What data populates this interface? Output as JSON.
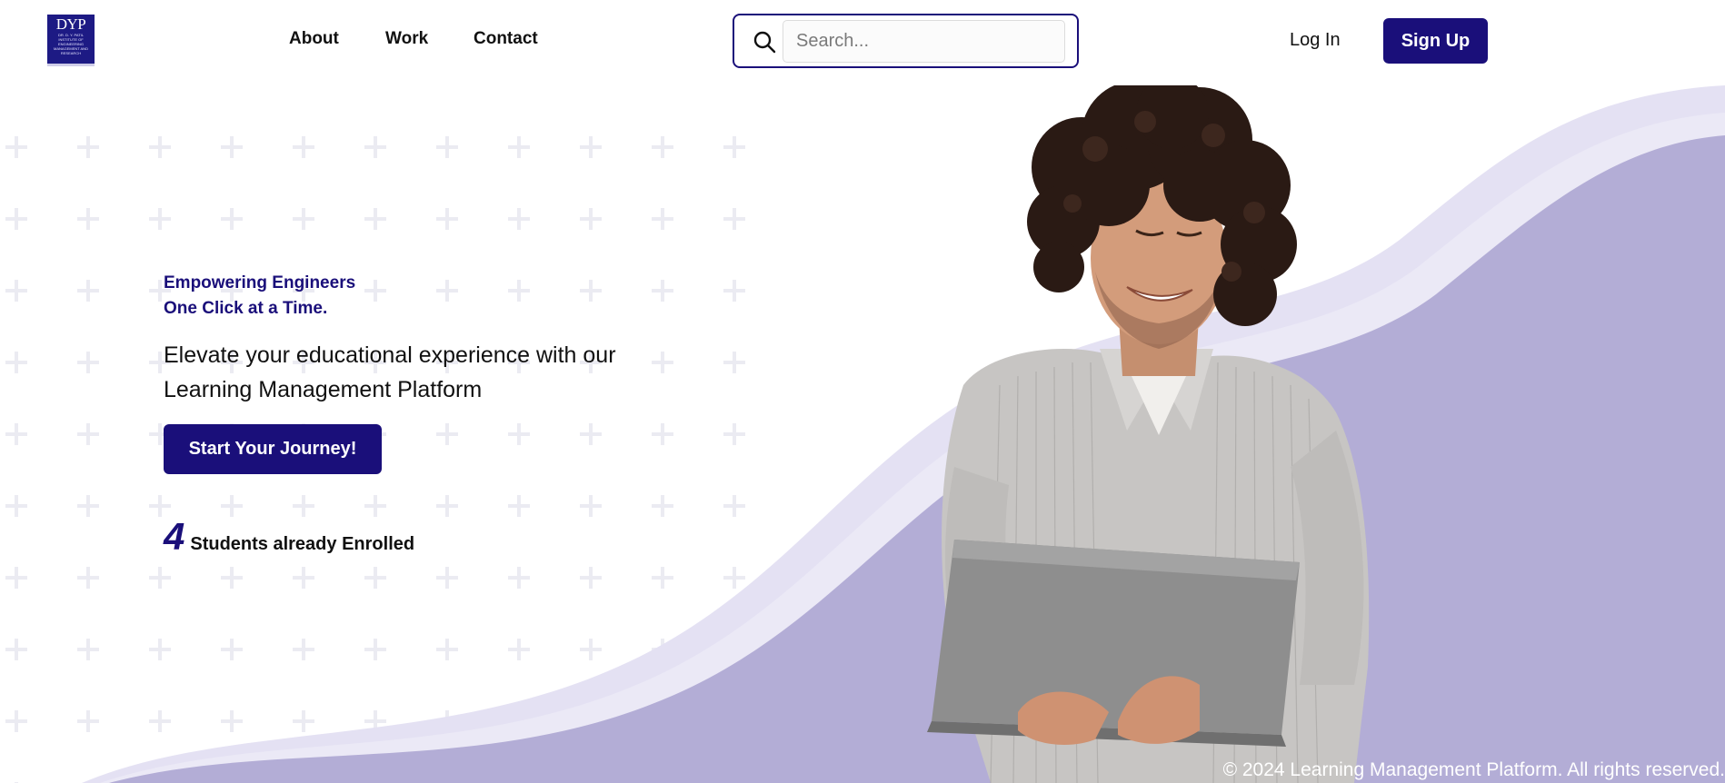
{
  "header": {
    "logo_text": "DYP",
    "logo_subtext": "DR. D. Y. PATIL INSTITUTE OF ENGINEERING MANAGEMENT AND RESEARCH",
    "nav": [
      {
        "label": "About"
      },
      {
        "label": "Work"
      },
      {
        "label": "Contact"
      }
    ],
    "search": {
      "placeholder": "Search...",
      "value": ""
    },
    "login_label": "Log In",
    "signup_label": "Sign Up"
  },
  "hero": {
    "tagline_line1": "Empowering Engineers",
    "tagline_line2": "One Click at a Time.",
    "headline": "Elevate your educational experience with our Learning Management Platform",
    "cta_label": "Start Your Journey!",
    "enrolled_count": "4",
    "enrolled_label": "Students already Enrolled"
  },
  "footer": {
    "copyright": "© 2024 Learning Management Platform. All rights reserved."
  },
  "colors": {
    "brand": "#1a0f7a",
    "wave": "#b3add6",
    "wave_light": "#dcd9ee"
  }
}
